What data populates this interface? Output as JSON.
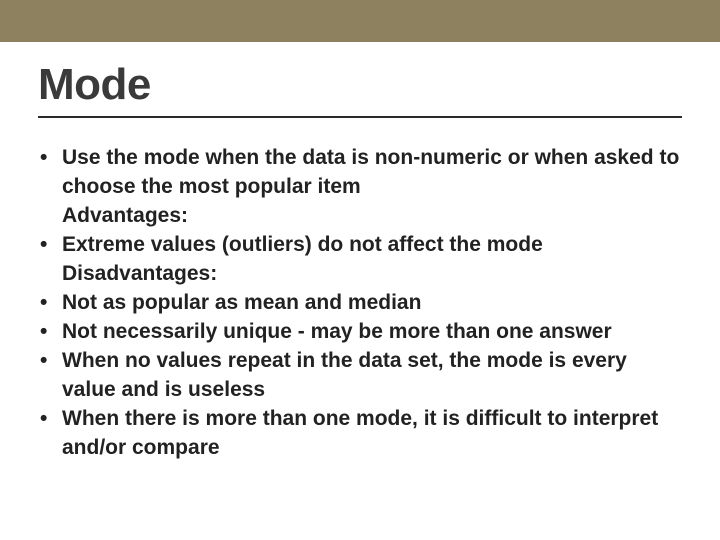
{
  "title": "Mode",
  "bullets": {
    "intro": "Use the mode when the data is non-numeric or when asked to choose the most popular item",
    "adv_label": "Advantages:",
    "adv1": " Extreme values (outliers) do not affect the mode",
    "dis_label": "Disadvantages:",
    "dis1": "Not as popular as mean and median",
    "dis2": "Not necessarily unique - may be more than one answer",
    "dis3": "When no values repeat in the data set, the mode is every value and is useless",
    "dis4": "When there is more than one mode, it is difficult to interpret and/or compare"
  }
}
